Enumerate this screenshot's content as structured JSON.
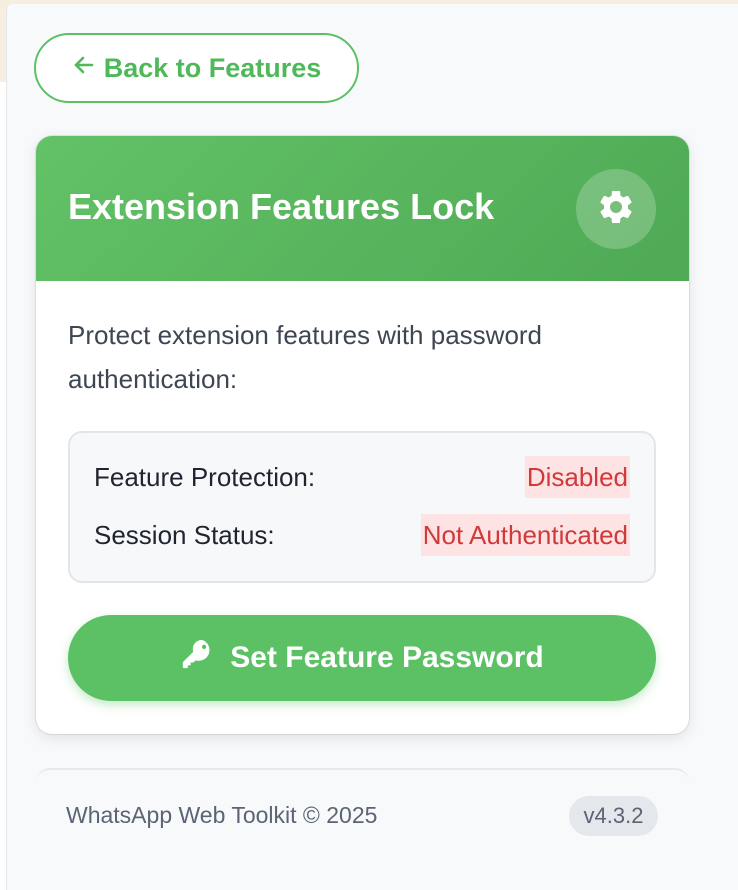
{
  "back_button": {
    "label": "Back to Features",
    "icon": "arrow-left-icon"
  },
  "card": {
    "title": "Extension Features Lock",
    "settings_icon": "gear-icon",
    "description": "Protect extension features with password authentication:",
    "status": [
      {
        "label": "Feature Protection:",
        "value": "Disabled"
      },
      {
        "label": "Session Status:",
        "value": "Not Authenticated"
      }
    ],
    "action_button": {
      "label": "Set Feature Password",
      "icon": "key-icon"
    }
  },
  "footer": {
    "text": "WhatsApp Web Toolkit © 2025",
    "version": "v4.3.2"
  },
  "colors": {
    "accent": "#5cc065",
    "status_negative": "#d03a3a",
    "status_negative_bg": "#fde3e3"
  }
}
